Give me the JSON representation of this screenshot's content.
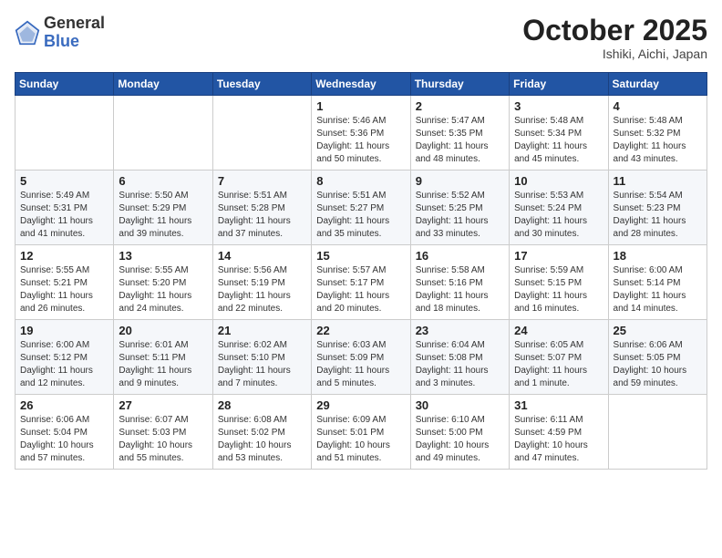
{
  "header": {
    "logo_general": "General",
    "logo_blue": "Blue",
    "month": "October 2025",
    "location": "Ishiki, Aichi, Japan"
  },
  "days_of_week": [
    "Sunday",
    "Monday",
    "Tuesday",
    "Wednesday",
    "Thursday",
    "Friday",
    "Saturday"
  ],
  "weeks": [
    [
      {
        "day": "",
        "detail": ""
      },
      {
        "day": "",
        "detail": ""
      },
      {
        "day": "",
        "detail": ""
      },
      {
        "day": "1",
        "detail": "Sunrise: 5:46 AM\nSunset: 5:36 PM\nDaylight: 11 hours\nand 50 minutes."
      },
      {
        "day": "2",
        "detail": "Sunrise: 5:47 AM\nSunset: 5:35 PM\nDaylight: 11 hours\nand 48 minutes."
      },
      {
        "day": "3",
        "detail": "Sunrise: 5:48 AM\nSunset: 5:34 PM\nDaylight: 11 hours\nand 45 minutes."
      },
      {
        "day": "4",
        "detail": "Sunrise: 5:48 AM\nSunset: 5:32 PM\nDaylight: 11 hours\nand 43 minutes."
      }
    ],
    [
      {
        "day": "5",
        "detail": "Sunrise: 5:49 AM\nSunset: 5:31 PM\nDaylight: 11 hours\nand 41 minutes."
      },
      {
        "day": "6",
        "detail": "Sunrise: 5:50 AM\nSunset: 5:29 PM\nDaylight: 11 hours\nand 39 minutes."
      },
      {
        "day": "7",
        "detail": "Sunrise: 5:51 AM\nSunset: 5:28 PM\nDaylight: 11 hours\nand 37 minutes."
      },
      {
        "day": "8",
        "detail": "Sunrise: 5:51 AM\nSunset: 5:27 PM\nDaylight: 11 hours\nand 35 minutes."
      },
      {
        "day": "9",
        "detail": "Sunrise: 5:52 AM\nSunset: 5:25 PM\nDaylight: 11 hours\nand 33 minutes."
      },
      {
        "day": "10",
        "detail": "Sunrise: 5:53 AM\nSunset: 5:24 PM\nDaylight: 11 hours\nand 30 minutes."
      },
      {
        "day": "11",
        "detail": "Sunrise: 5:54 AM\nSunset: 5:23 PM\nDaylight: 11 hours\nand 28 minutes."
      }
    ],
    [
      {
        "day": "12",
        "detail": "Sunrise: 5:55 AM\nSunset: 5:21 PM\nDaylight: 11 hours\nand 26 minutes."
      },
      {
        "day": "13",
        "detail": "Sunrise: 5:55 AM\nSunset: 5:20 PM\nDaylight: 11 hours\nand 24 minutes."
      },
      {
        "day": "14",
        "detail": "Sunrise: 5:56 AM\nSunset: 5:19 PM\nDaylight: 11 hours\nand 22 minutes."
      },
      {
        "day": "15",
        "detail": "Sunrise: 5:57 AM\nSunset: 5:17 PM\nDaylight: 11 hours\nand 20 minutes."
      },
      {
        "day": "16",
        "detail": "Sunrise: 5:58 AM\nSunset: 5:16 PM\nDaylight: 11 hours\nand 18 minutes."
      },
      {
        "day": "17",
        "detail": "Sunrise: 5:59 AM\nSunset: 5:15 PM\nDaylight: 11 hours\nand 16 minutes."
      },
      {
        "day": "18",
        "detail": "Sunrise: 6:00 AM\nSunset: 5:14 PM\nDaylight: 11 hours\nand 14 minutes."
      }
    ],
    [
      {
        "day": "19",
        "detail": "Sunrise: 6:00 AM\nSunset: 5:12 PM\nDaylight: 11 hours\nand 12 minutes."
      },
      {
        "day": "20",
        "detail": "Sunrise: 6:01 AM\nSunset: 5:11 PM\nDaylight: 11 hours\nand 9 minutes."
      },
      {
        "day": "21",
        "detail": "Sunrise: 6:02 AM\nSunset: 5:10 PM\nDaylight: 11 hours\nand 7 minutes."
      },
      {
        "day": "22",
        "detail": "Sunrise: 6:03 AM\nSunset: 5:09 PM\nDaylight: 11 hours\nand 5 minutes."
      },
      {
        "day": "23",
        "detail": "Sunrise: 6:04 AM\nSunset: 5:08 PM\nDaylight: 11 hours\nand 3 minutes."
      },
      {
        "day": "24",
        "detail": "Sunrise: 6:05 AM\nSunset: 5:07 PM\nDaylight: 11 hours\nand 1 minute."
      },
      {
        "day": "25",
        "detail": "Sunrise: 6:06 AM\nSunset: 5:05 PM\nDaylight: 10 hours\nand 59 minutes."
      }
    ],
    [
      {
        "day": "26",
        "detail": "Sunrise: 6:06 AM\nSunset: 5:04 PM\nDaylight: 10 hours\nand 57 minutes."
      },
      {
        "day": "27",
        "detail": "Sunrise: 6:07 AM\nSunset: 5:03 PM\nDaylight: 10 hours\nand 55 minutes."
      },
      {
        "day": "28",
        "detail": "Sunrise: 6:08 AM\nSunset: 5:02 PM\nDaylight: 10 hours\nand 53 minutes."
      },
      {
        "day": "29",
        "detail": "Sunrise: 6:09 AM\nSunset: 5:01 PM\nDaylight: 10 hours\nand 51 minutes."
      },
      {
        "day": "30",
        "detail": "Sunrise: 6:10 AM\nSunset: 5:00 PM\nDaylight: 10 hours\nand 49 minutes."
      },
      {
        "day": "31",
        "detail": "Sunrise: 6:11 AM\nSunset: 4:59 PM\nDaylight: 10 hours\nand 47 minutes."
      },
      {
        "day": "",
        "detail": ""
      }
    ]
  ]
}
